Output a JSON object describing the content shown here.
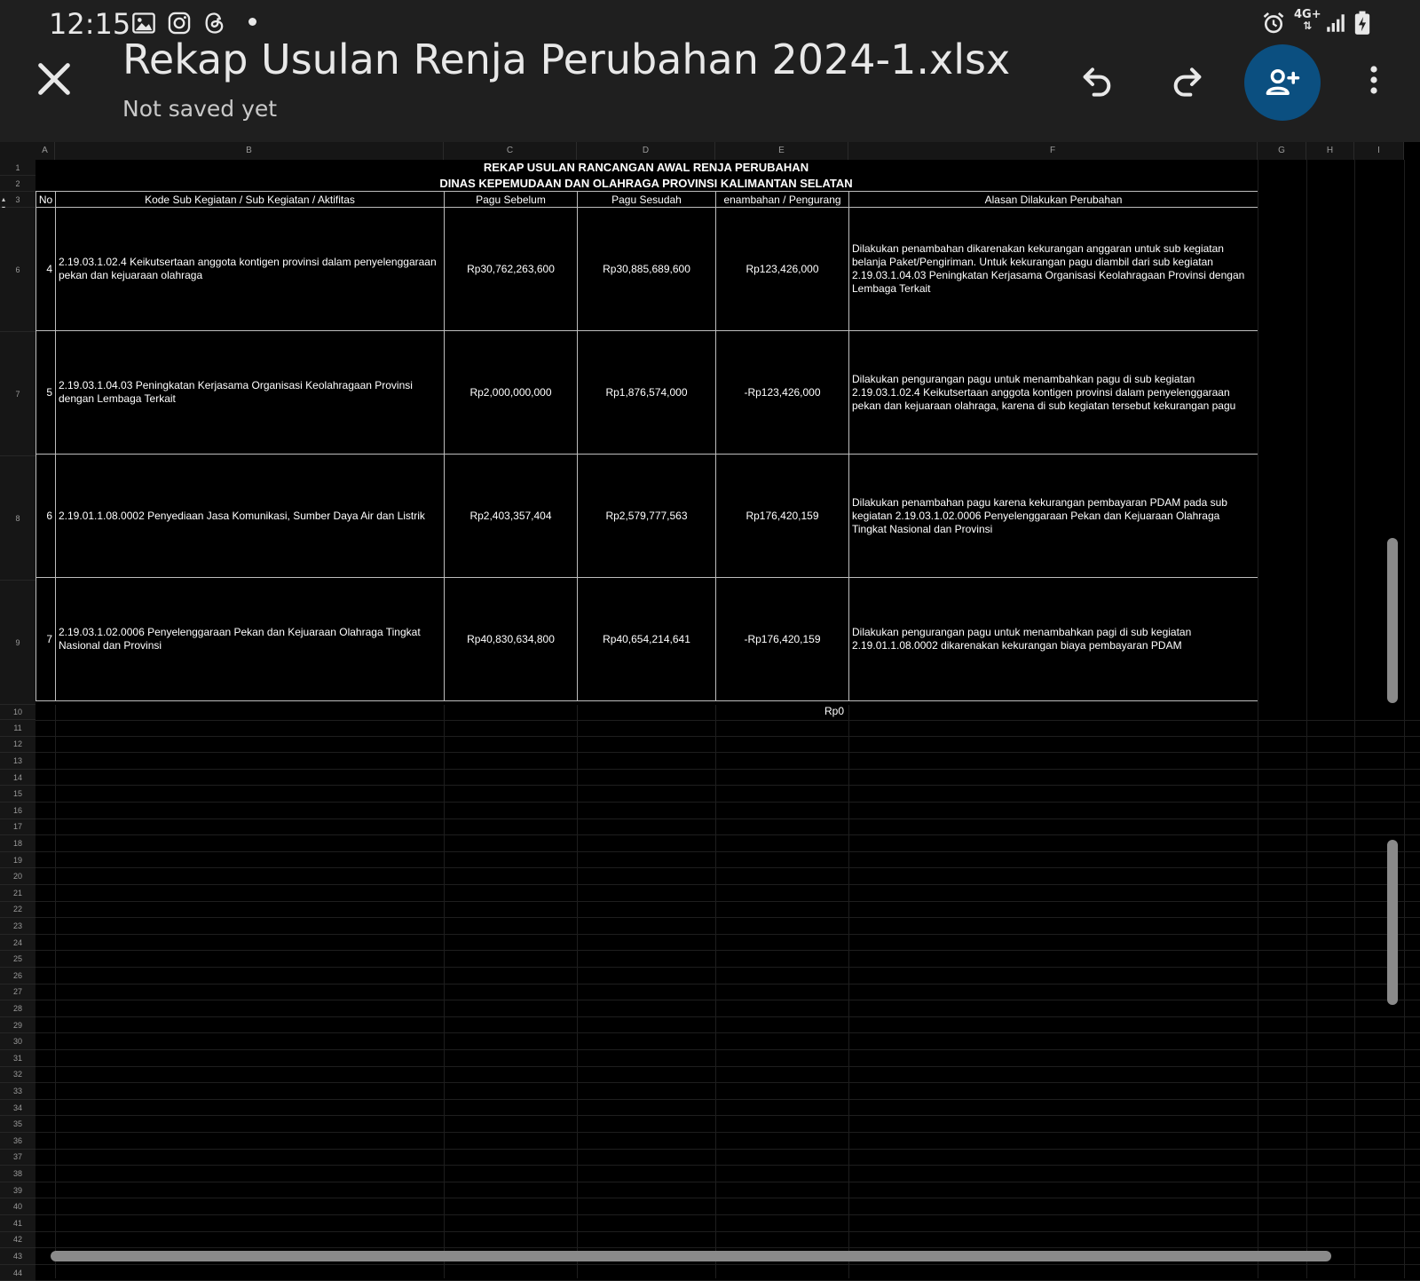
{
  "status_bar": {
    "time": "12:15",
    "network": "4G+"
  },
  "app_bar": {
    "title": "Rekap Usulan Renja Perubahan 2024-1.xlsx",
    "subtitle": "Not saved yet"
  },
  "sheet": {
    "columns": [
      "A",
      "B",
      "C",
      "D",
      "E",
      "F",
      "G",
      "H",
      "I"
    ],
    "title_line1": "REKAP USULAN RANCANGAN AWAL RENJA PERUBAHAN",
    "title_line2": "DINAS KEPEMUDAAN DAN OLAHRAGA PROVINSI KALIMANTAN SELATAN",
    "headers": [
      "No",
      "Kode Sub Kegiatan / Sub Kegiatan / Aktifitas",
      "Pagu Sebelum",
      "Pagu Sesudah",
      "enambahan / Pengurang",
      "Alasan Dilakukan Perubahan"
    ],
    "row_numbers_top": [
      "1",
      "2",
      "3"
    ],
    "rows": [
      {
        "row_number": "6",
        "no": "4",
        "kegiatan": "2.19.03.1.02.4 Keikutsertaan anggota kontigen provinsi dalam penyelenggaraan pekan dan kejuaraan olahraga",
        "pagu_sebelum": "Rp30,762,263,600",
        "pagu_sesudah": "Rp30,885,689,600",
        "selisih": "Rp123,426,000",
        "alasan": "Dilakukan penambahan dikarenakan kekurangan anggaran untuk sub kegiatan belanja Paket/Pengiriman. Untuk kekurangan pagu diambil dari sub kegiatan 2.19.03.1.04.03 Peningkatan Kerjasama Organisasi Keolahragaan Provinsi dengan Lembaga Terkait"
      },
      {
        "row_number": "7",
        "no": "5",
        "kegiatan": "2.19.03.1.04.03 Peningkatan Kerjasama Organisasi Keolahragaan Provinsi dengan Lembaga Terkait",
        "pagu_sebelum": "Rp2,000,000,000",
        "pagu_sesudah": "Rp1,876,574,000",
        "selisih": "-Rp123,426,000",
        "alasan": "Dilakukan pengurangan pagu untuk menambahkan pagu di sub kegiatan 2.19.03.1.02.4 Keikutsertaan anggota kontigen provinsi dalam penyelenggaraan pekan dan kejuaraan olahraga, karena di sub kegiatan tersebut kekurangan pagu"
      },
      {
        "row_number": "8",
        "no": "6",
        "kegiatan": "2.19.01.1.08.0002 Penyediaan Jasa Komunikasi, Sumber Daya Air dan Listrik",
        "pagu_sebelum": "Rp2,403,357,404",
        "pagu_sesudah": "Rp2,579,777,563",
        "selisih": "Rp176,420,159",
        "alasan": "Dilakukan penambahan pagu karena kekurangan pembayaran PDAM pada sub kegiatan 2.19.03.1.02.0006 Penyelenggaraan Pekan dan Kejuaraan Olahraga Tingkat Nasional dan Provinsi"
      },
      {
        "row_number": "9",
        "no": "7",
        "kegiatan": "2.19.03.1.02.0006 Penyelenggaraan Pekan dan Kejuaraan Olahraga Tingkat Nasional dan Provinsi",
        "pagu_sebelum": "Rp40,830,634,800",
        "pagu_sesudah": "Rp40,654,214,641",
        "selisih": "-Rp176,420,159",
        "alasan": "Dilakukan pengurangan pagu untuk menambahkan pagi di sub kegiatan 2.19.01.1.08.0002 dikarenakan kekurangan biaya pembayaran PDAM"
      }
    ],
    "total_row_number": "10",
    "total_value": "Rp0",
    "empty_rows": [
      "11",
      "12",
      "13",
      "14",
      "15",
      "16",
      "17",
      "18",
      "19",
      "20",
      "21",
      "22",
      "23",
      "24",
      "25",
      "26",
      "27",
      "28",
      "29",
      "30",
      "31",
      "32",
      "33",
      "34",
      "35",
      "36",
      "37",
      "38",
      "39",
      "40",
      "41",
      "42",
      "43",
      "44"
    ]
  },
  "colors": {
    "share_button": "#0b4f80",
    "app_bar_bg": "#1f1f1f",
    "sheet_bg": "#000000"
  },
  "icons": [
    "gallery-icon",
    "instagram-icon",
    "threads-icon",
    "alarm-icon",
    "signal-icon",
    "battery-charging-icon",
    "close-icon",
    "undo-icon",
    "redo-icon",
    "add-person-icon",
    "more-vert-icon"
  ]
}
